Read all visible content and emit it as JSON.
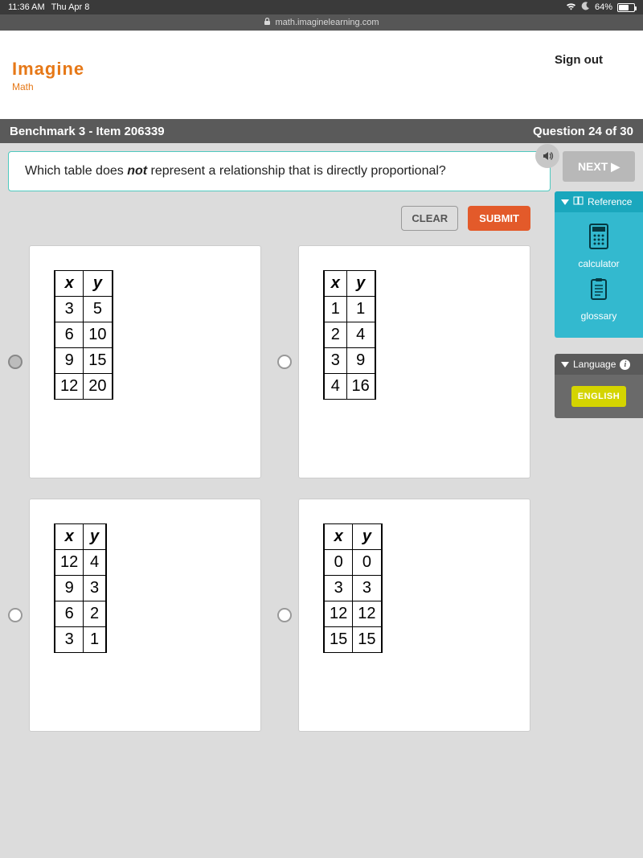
{
  "statusbar": {
    "time": "11:36 AM",
    "date": "Thu Apr 8",
    "battery": "64%"
  },
  "url": "math.imaginelearning.com",
  "logo": {
    "line1": "Imagine",
    "line2": "Math"
  },
  "signout": "Sign out",
  "titlebar": {
    "left": "Benchmark 3 - Item 206339",
    "right": "Question 24 of 30"
  },
  "question": {
    "pre": "Which table does ",
    "em": "not",
    "post": " represent a relationship that is directly proportional?"
  },
  "buttons": {
    "next": "NEXT",
    "clear": "CLEAR",
    "submit": "SUBMIT"
  },
  "headers": {
    "x": "x",
    "y": "y"
  },
  "options": [
    {
      "selected": true,
      "rows": [
        [
          "3",
          "5"
        ],
        [
          "6",
          "10"
        ],
        [
          "9",
          "15"
        ],
        [
          "12",
          "20"
        ]
      ]
    },
    {
      "selected": false,
      "rows": [
        [
          "1",
          "1"
        ],
        [
          "2",
          "4"
        ],
        [
          "3",
          "9"
        ],
        [
          "4",
          "16"
        ]
      ]
    },
    {
      "selected": false,
      "rows": [
        [
          "12",
          "4"
        ],
        [
          "9",
          "3"
        ],
        [
          "6",
          "2"
        ],
        [
          "3",
          "1"
        ]
      ]
    },
    {
      "selected": false,
      "rows": [
        [
          "0",
          "0"
        ],
        [
          "3",
          "3"
        ],
        [
          "12",
          "12"
        ],
        [
          "15",
          "15"
        ]
      ]
    }
  ],
  "side": {
    "reference": {
      "title": "Reference",
      "calc": "calculator",
      "gloss": "glossary"
    },
    "language": {
      "title": "Language",
      "button": "ENGLISH"
    }
  }
}
